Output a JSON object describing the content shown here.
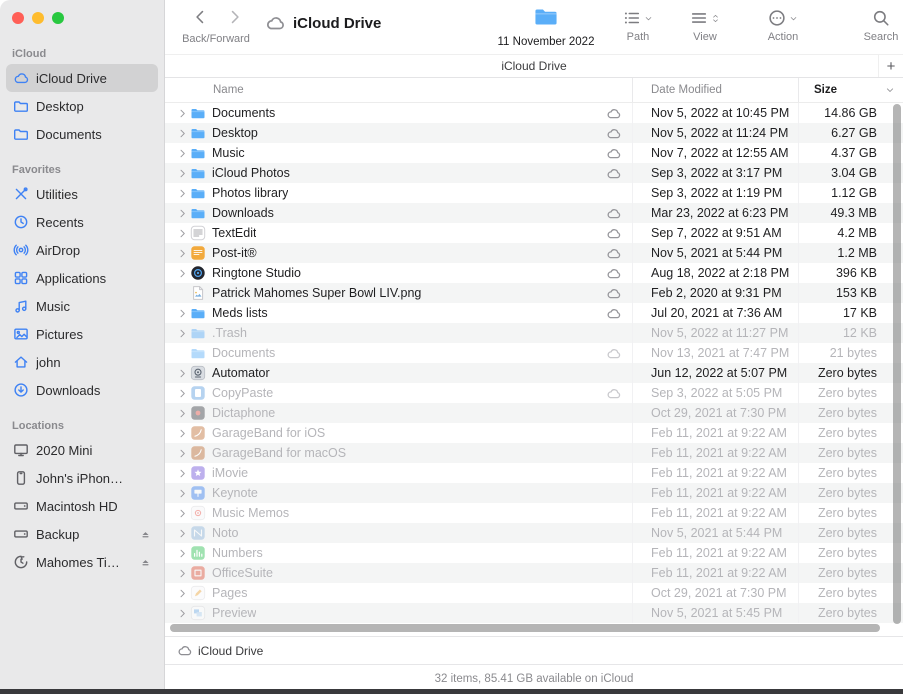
{
  "window": {
    "traffic_lights": [
      {
        "name": "close",
        "color": "#ff5f57"
      },
      {
        "name": "minimize",
        "color": "#febc2e"
      },
      {
        "name": "zoom",
        "color": "#28c840"
      }
    ]
  },
  "sidebar": {
    "sections": [
      {
        "title": "iCloud",
        "items": [
          {
            "label": "iCloud Drive",
            "icon": "cloud-icon",
            "selected": true
          },
          {
            "label": "Desktop",
            "icon": "folder-icon"
          },
          {
            "label": "Documents",
            "icon": "folder-icon"
          }
        ]
      },
      {
        "title": "Favorites",
        "items": [
          {
            "label": "Utilities",
            "icon": "utilities-icon"
          },
          {
            "label": "Recents",
            "icon": "clock-icon"
          },
          {
            "label": "AirDrop",
            "icon": "airdrop-icon"
          },
          {
            "label": "Applications",
            "icon": "applications-icon"
          },
          {
            "label": "Music",
            "icon": "music-note-icon"
          },
          {
            "label": "Pictures",
            "icon": "pictures-icon"
          },
          {
            "label": "john",
            "icon": "home-icon"
          },
          {
            "label": "Downloads",
            "icon": "downloads-icon"
          }
        ]
      },
      {
        "title": "Locations",
        "items": [
          {
            "label": "2020 Mini",
            "icon": "display-icon"
          },
          {
            "label": "John's iPhon…",
            "icon": "iphone-icon"
          },
          {
            "label": "Macintosh HD",
            "icon": "hdd-icon"
          },
          {
            "label": "Backup",
            "icon": "hdd-icon",
            "eject": true
          },
          {
            "label": "Mahomes Ti…",
            "icon": "time-machine-icon",
            "eject": true
          }
        ]
      }
    ]
  },
  "toolbar": {
    "back_forward_label": "Back/Forward",
    "title": "iCloud Drive",
    "dragged_item_label": "11 November 2022",
    "buttons": [
      {
        "label": "Path",
        "icon": "path-icon"
      },
      {
        "label": "View",
        "icon": "view-list-icon"
      },
      {
        "label": "Action",
        "icon": "action-icon"
      },
      {
        "label": "Search",
        "icon": "search-icon"
      }
    ]
  },
  "tabbar": {
    "tab_label": "iCloud Drive",
    "new_tab_label": "+"
  },
  "columns": {
    "name": "Name",
    "date_modified": "Date Modified",
    "size": "Size"
  },
  "rows": [
    {
      "name": "Documents",
      "date": "Nov 5, 2022 at 10:45 PM",
      "size": "14.86 GB",
      "icon": "folder-icon",
      "cloud": true,
      "chevron": true,
      "dimmed": false
    },
    {
      "name": "Desktop",
      "date": "Nov 5, 2022 at 11:24 PM",
      "size": "6.27 GB",
      "icon": "folder-icon",
      "cloud": true,
      "chevron": true,
      "dimmed": false
    },
    {
      "name": "Music",
      "date": "Nov 7, 2022 at 12:55 AM",
      "size": "4.37 GB",
      "icon": "folder-icon",
      "cloud": true,
      "chevron": true,
      "dimmed": false
    },
    {
      "name": "iCloud Photos",
      "date": "Sep 3, 2022 at 3:17 PM",
      "size": "3.04 GB",
      "icon": "folder-icon",
      "cloud": true,
      "chevron": true,
      "dimmed": false
    },
    {
      "name": "Photos library",
      "date": "Sep 3, 2022 at 1:19 PM",
      "size": "1.12 GB",
      "icon": "folder-icon",
      "cloud": false,
      "chevron": true,
      "dimmed": false
    },
    {
      "name": "Downloads",
      "date": "Mar 23, 2022 at 6:23 PM",
      "size": "49.3 MB",
      "icon": "folder-icon",
      "cloud": true,
      "chevron": true,
      "dimmed": false
    },
    {
      "name": "TextEdit",
      "date": "Sep 7, 2022 at 9:51 AM",
      "size": "4.2 MB",
      "icon": "textedit-icon",
      "cloud": true,
      "chevron": true,
      "dimmed": false
    },
    {
      "name": "Post-it®",
      "date": "Nov 5, 2021 at 5:44 PM",
      "size": "1.2 MB",
      "icon": "postit-icon",
      "cloud": true,
      "chevron": true,
      "dimmed": false
    },
    {
      "name": "Ringtone Studio",
      "date": "Aug 18, 2022 at 2:18 PM",
      "size": "396 KB",
      "icon": "ringtone-icon",
      "cloud": true,
      "chevron": true,
      "dimmed": false
    },
    {
      "name": "Patrick Mahomes Super Bowl LIV.png",
      "date": "Feb 2, 2020 at 9:31 PM",
      "size": "153 KB",
      "icon": "image-file-icon",
      "cloud": true,
      "chevron": false,
      "dimmed": false
    },
    {
      "name": "Meds lists",
      "date": "Jul 20, 2021 at 7:36 AM",
      "size": "17 KB",
      "icon": "folder-icon",
      "cloud": true,
      "chevron": true,
      "dimmed": false
    },
    {
      "name": ".Trash",
      "date": "Nov 5, 2022 at 11:27 PM",
      "size": "12 KB",
      "icon": "folder-icon",
      "cloud": false,
      "chevron": true,
      "dimmed": true
    },
    {
      "name": "Documents",
      "date": "Nov 13, 2021 at 7:47 PM",
      "size": "21 bytes",
      "icon": "folder-icon",
      "cloud": true,
      "chevron": false,
      "dimmed": true
    },
    {
      "name": "Automator",
      "date": "Jun 12, 2022 at 5:07 PM",
      "size": "Zero bytes",
      "icon": "automator-icon",
      "cloud": false,
      "chevron": true,
      "dimmed": false
    },
    {
      "name": "CopyPaste",
      "date": "Sep 3, 2022 at 5:05 PM",
      "size": "Zero bytes",
      "icon": "copypaste-icon",
      "cloud": true,
      "chevron": true,
      "dimmed": true
    },
    {
      "name": "Dictaphone",
      "date": "Oct 29, 2021 at 7:30 PM",
      "size": "Zero bytes",
      "icon": "dictaphone-icon",
      "cloud": false,
      "chevron": true,
      "dimmed": true
    },
    {
      "name": "GarageBand for iOS",
      "date": "Feb 11, 2021 at 9:22 AM",
      "size": "Zero bytes",
      "icon": "garageband-icon",
      "cloud": false,
      "chevron": true,
      "dimmed": true
    },
    {
      "name": "GarageBand for macOS",
      "date": "Feb 11, 2021 at 9:22 AM",
      "size": "Zero bytes",
      "icon": "garageband-icon",
      "cloud": false,
      "chevron": true,
      "dimmed": true
    },
    {
      "name": "iMovie",
      "date": "Feb 11, 2021 at 9:22 AM",
      "size": "Zero bytes",
      "icon": "imovie-icon",
      "cloud": false,
      "chevron": true,
      "dimmed": true
    },
    {
      "name": "Keynote",
      "date": "Feb 11, 2021 at 9:22 AM",
      "size": "Zero bytes",
      "icon": "keynote-icon",
      "cloud": false,
      "chevron": true,
      "dimmed": true
    },
    {
      "name": "Music Memos",
      "date": "Feb 11, 2021 at 9:22 AM",
      "size": "Zero bytes",
      "icon": "musicmemos-icon",
      "cloud": false,
      "chevron": true,
      "dimmed": true
    },
    {
      "name": "Noto",
      "date": "Nov 5, 2021 at 5:44 PM",
      "size": "Zero bytes",
      "icon": "noto-icon",
      "cloud": false,
      "chevron": true,
      "dimmed": true
    },
    {
      "name": "Numbers",
      "date": "Feb 11, 2021 at 9:22 AM",
      "size": "Zero bytes",
      "icon": "numbers-icon",
      "cloud": false,
      "chevron": true,
      "dimmed": true
    },
    {
      "name": "OfficeSuite",
      "date": "Feb 11, 2021 at 9:22 AM",
      "size": "Zero bytes",
      "icon": "officesuite-icon",
      "cloud": false,
      "chevron": true,
      "dimmed": true
    },
    {
      "name": "Pages",
      "date": "Oct 29, 2021 at 7:30 PM",
      "size": "Zero bytes",
      "icon": "pages-icon",
      "cloud": false,
      "chevron": true,
      "dimmed": true
    },
    {
      "name": "Preview",
      "date": "Nov 5, 2021 at 5:45 PM",
      "size": "Zero bytes",
      "icon": "preview-icon",
      "cloud": false,
      "chevron": true,
      "dimmed": true
    }
  ],
  "footer": {
    "path_item": "iCloud Drive",
    "status": "32 items, 85.41 GB available on iCloud"
  },
  "colors": {
    "accent_blue": "#3f82f4",
    "folder_blue": "#5aaef8",
    "sidebar_bg": "#e9e9ea",
    "selected_item_bg": "#d2d2d3",
    "row_stripe": "#f4f5f5",
    "dimmed_text": "#b5b5b9"
  }
}
